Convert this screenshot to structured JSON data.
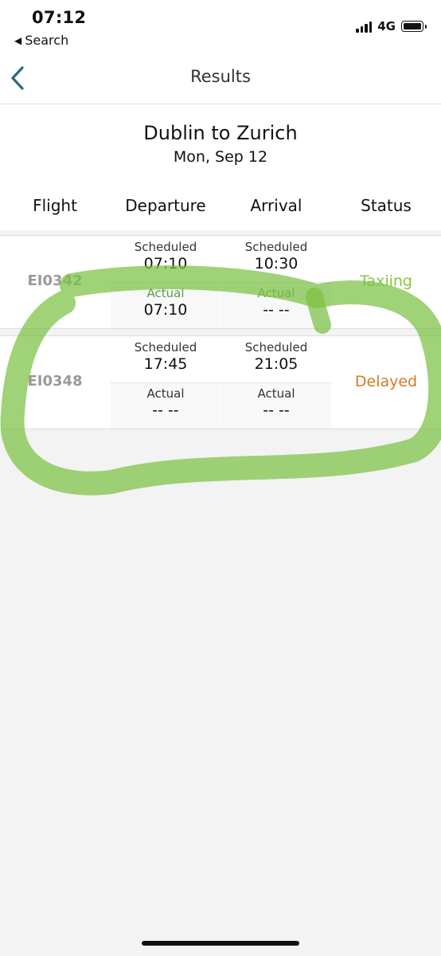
{
  "status_bar": {
    "time": "07:12",
    "back_app": "Search",
    "network": "4G"
  },
  "nav": {
    "title": "Results",
    "back_icon": "chevron-left-icon"
  },
  "route": {
    "title": "Dublin to Zurich",
    "date": "Mon, Sep 12"
  },
  "columns": {
    "flight": "Flight",
    "departure": "Departure",
    "arrival": "Arrival",
    "status": "Status"
  },
  "flights": [
    {
      "number": "EI0342",
      "departure": {
        "scheduled_label": "Scheduled",
        "scheduled": "07:10",
        "actual_label": "Actual",
        "actual": "07:10"
      },
      "arrival": {
        "scheduled_label": "Scheduled",
        "scheduled": "10:30",
        "actual_label": "Actual",
        "actual": "-- --"
      },
      "status": "Taxiing",
      "status_color": "#8cc43f"
    },
    {
      "number": "EI0348",
      "departure": {
        "scheduled_label": "Scheduled",
        "scheduled": "17:45",
        "actual_label": "Actual",
        "actual": "-- --"
      },
      "arrival": {
        "scheduled_label": "Scheduled",
        "scheduled": "21:05",
        "actual_label": "Actual",
        "actual": "-- --"
      },
      "status": "Delayed",
      "status_color": "#d47a24"
    }
  ],
  "colors": {
    "annotation": "#7bc043",
    "taxiing": "#8cc43f",
    "delayed": "#d47a24",
    "actual_label_active": "#5f9a48",
    "nav_back": "#2c6a78"
  }
}
